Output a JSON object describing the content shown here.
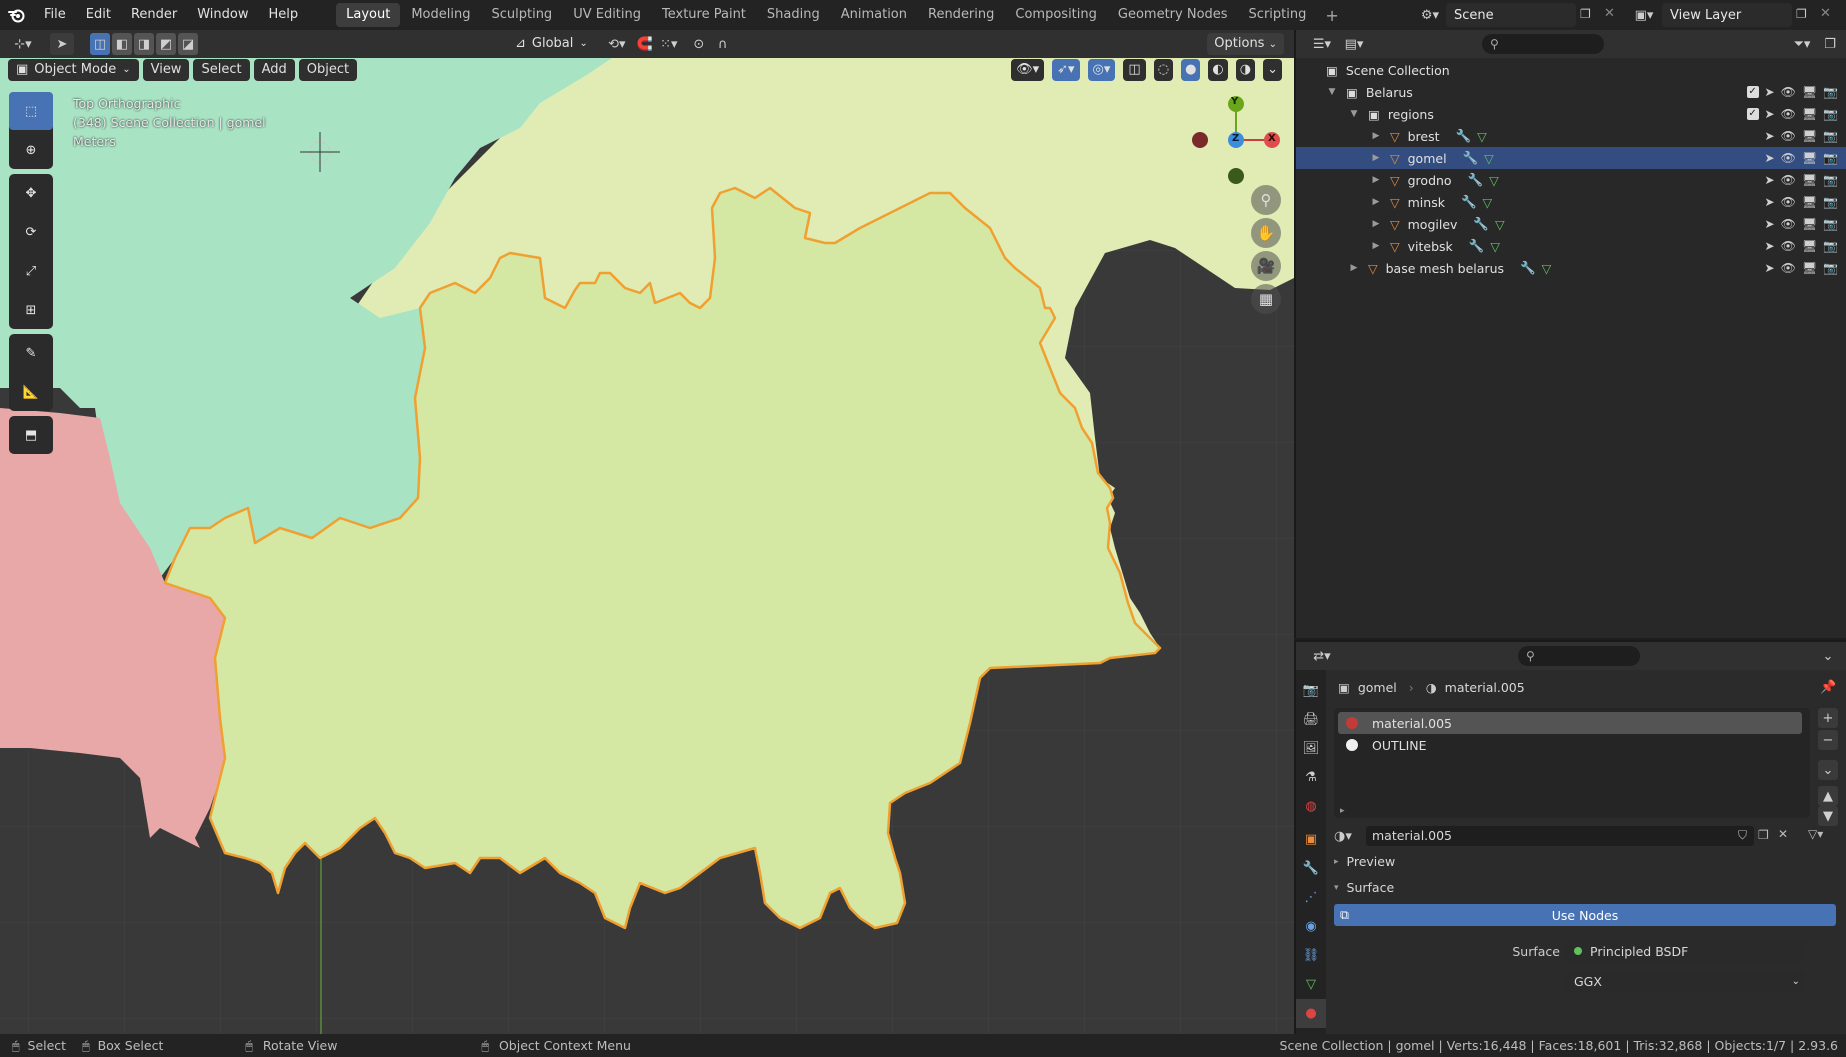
{
  "menubar": {
    "items": [
      "File",
      "Edit",
      "Render",
      "Window",
      "Help"
    ]
  },
  "workspaces": {
    "tabs": [
      "Layout",
      "Modeling",
      "Sculpting",
      "UV Editing",
      "Texture Paint",
      "Shading",
      "Animation",
      "Rendering",
      "Compositing",
      "Geometry Nodes",
      "Scripting"
    ],
    "active": "Layout"
  },
  "scene": {
    "name": "Scene"
  },
  "view_layer": {
    "name": "View Layer"
  },
  "viewport_header": {
    "orientation": "Global",
    "options_label": "Options"
  },
  "viewport_menus": {
    "mode": "Object Mode",
    "view": "View",
    "select": "Select",
    "add": "Add",
    "object": "Object"
  },
  "viewport_info": {
    "line1": "Top Orthographic",
    "line2": "(348) Scene Collection | gomel",
    "line3": "Meters"
  },
  "gizmo": {
    "y": "Y",
    "z": "Z",
    "x": "X"
  },
  "outliner": {
    "root": "Scene Collection",
    "rows": [
      {
        "label": "Belarus",
        "kind": "collection",
        "indent": 1
      },
      {
        "label": "regions",
        "kind": "collection",
        "indent": 2
      },
      {
        "label": "brest",
        "kind": "mesh",
        "indent": 3
      },
      {
        "label": "gomel",
        "kind": "mesh",
        "indent": 3,
        "selected": true
      },
      {
        "label": "grodno",
        "kind": "mesh",
        "indent": 3
      },
      {
        "label": "minsk",
        "kind": "mesh",
        "indent": 3
      },
      {
        "label": "mogilev",
        "kind": "mesh",
        "indent": 3
      },
      {
        "label": "vitebsk",
        "kind": "mesh",
        "indent": 3
      },
      {
        "label": "base mesh belarus",
        "kind": "mesh",
        "indent": 2
      }
    ]
  },
  "properties": {
    "object": "gomel",
    "material": "material.005",
    "slots": [
      {
        "name": "material.005",
        "color": "#c23a3a",
        "selected": true
      },
      {
        "name": "OUTLINE",
        "color": "#f0f0f0"
      }
    ],
    "material_field": "material.005",
    "preview_label": "Preview",
    "surface_section": "Surface",
    "use_nodes": "Use Nodes",
    "surface_label": "Surface",
    "surface_value": "Principled BSDF",
    "distribution": "GGX"
  },
  "statusbar": {
    "select": "Select",
    "box_select": "Box Select",
    "rotate": "Rotate View",
    "context_menu": "Object Context Menu",
    "stats": "Scene Collection | gomel | Verts:16,448 | Faces:18,601 | Tris:32,868 | Objects:1/7 | 2.93.6"
  },
  "colors": {
    "accent": "#4772b3",
    "region_teal": "#a8e4c4",
    "region_yellow": "#e0ecb4",
    "region_green": "#d4e8a4",
    "region_pink": "#e8a8a8",
    "outline": "#f0a030",
    "mesh_orange": "#e88b3a"
  }
}
